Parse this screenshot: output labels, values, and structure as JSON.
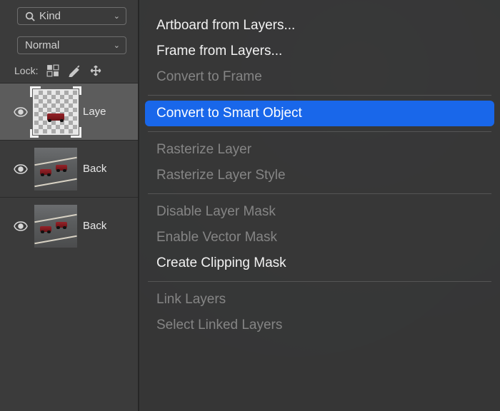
{
  "panel": {
    "filter": {
      "label": "Kind"
    },
    "blend_mode": "Normal",
    "lock_label": "Lock:"
  },
  "layers": [
    {
      "name": "Laye",
      "selected": true,
      "thumb": "transparent-car"
    },
    {
      "name": "Back",
      "selected": false,
      "thumb": "track"
    },
    {
      "name": "Back",
      "selected": false,
      "thumb": "track"
    }
  ],
  "menu": {
    "items": [
      {
        "label": "Artboard from Layers...",
        "enabled": true
      },
      {
        "label": "Frame from Layers...",
        "enabled": true
      },
      {
        "label": "Convert to Frame",
        "enabled": false
      },
      {
        "type": "separator"
      },
      {
        "label": "Convert to Smart Object",
        "enabled": true,
        "highlighted": true
      },
      {
        "type": "separator"
      },
      {
        "label": "Rasterize Layer",
        "enabled": false
      },
      {
        "label": "Rasterize Layer Style",
        "enabled": false
      },
      {
        "type": "separator"
      },
      {
        "label": "Disable Layer Mask",
        "enabled": false
      },
      {
        "label": "Enable Vector Mask",
        "enabled": false
      },
      {
        "label": "Create Clipping Mask",
        "enabled": true
      },
      {
        "type": "separator"
      },
      {
        "label": "Link Layers",
        "enabled": false
      },
      {
        "label": "Select Linked Layers",
        "enabled": false
      }
    ]
  }
}
